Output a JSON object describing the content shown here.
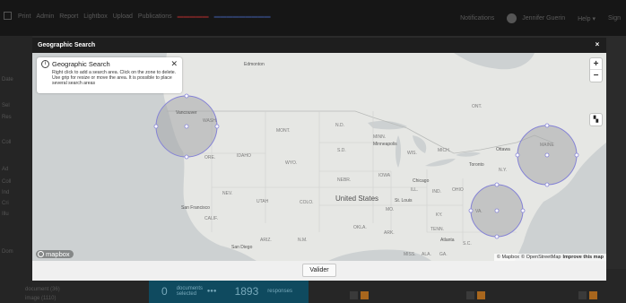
{
  "app": {
    "nav": [
      "Print",
      "Admin",
      "Report",
      "Lightbox",
      "Upload",
      "Publications"
    ],
    "notifications": "Notifications",
    "user": "Jennifer Guerin",
    "help": "Help ▾",
    "sign": "Sign"
  },
  "sidebar_labels": [
    "Date",
    "Sel",
    "Res",
    "Coll",
    "Ad",
    "Coll",
    "Ind",
    "Cri",
    "Illu",
    "Dom"
  ],
  "bottom": {
    "document_line": "document (36)",
    "image_line": "image (1110)",
    "selected_count": "0",
    "selected_label": "documents selected",
    "responses_count": "1893",
    "responses_label": "responses"
  },
  "modal": {
    "title": "Geographic Search",
    "close": "×",
    "info_title": "Geographic Search",
    "info_text": "Right click to add a search area. Click on the zone to delete. Use grip for resize or move the area. It is possible to place several search areas",
    "info_close": "✕",
    "zoom_in": "+",
    "zoom_out": "−",
    "fullscreen_icon": "map-icon",
    "logo": "mapbox",
    "attribution_1": "© Mapbox",
    "attribution_2": "© OpenStreetMap",
    "attribution_3": "Improve this map",
    "submit": "Valider"
  },
  "map_labels": {
    "edmonton": "Edmonton",
    "vancouver": "Vancouver",
    "wash": "WASH.",
    "mont": "MONT.",
    "nd": "N.D.",
    "sd": "S.D.",
    "minn": "MINN.",
    "minneapolis": "Minneapolis",
    "wis": "WIS.",
    "mich": "MICH.",
    "ont": "ONT.",
    "ottawa": "Ottawa",
    "maine": "MAINE",
    "toronto": "Toronto",
    "ny": "N.Y.",
    "ore": "ORE.",
    "idaho": "IDAHO",
    "wyo": "WYO.",
    "nev": "NEV.",
    "utah": "UTAH",
    "colo": "COLO.",
    "nebr": "NEBR.",
    "iowa": "IOWA",
    "ill": "ILL.",
    "ind": "IND.",
    "ohio": "OHIO",
    "chicago": "Chicago",
    "united_states": "United States",
    "st_louis": "St. Louis",
    "mo": "MO.",
    "ky": "KY.",
    "va": "VA.",
    "san_francisco": "San Francisco",
    "calif": "CALIF.",
    "ariz": "ARIZ.",
    "nm": "N.M.",
    "okla": "OKLA.",
    "ark": "ARK.",
    "tenn": "TENN.",
    "atlanta": "Atlanta",
    "sc": "S.C.",
    "san_diego": "San Diego",
    "miss": "MISS.",
    "ala": "ALA.",
    "ga": "GA."
  },
  "colors": {
    "land": "#e6e7e4",
    "water": "#cdd1d2",
    "circle_fill": "#a5a7a9",
    "circle_stroke": "#8583d6",
    "border": "#b9bbb9"
  }
}
